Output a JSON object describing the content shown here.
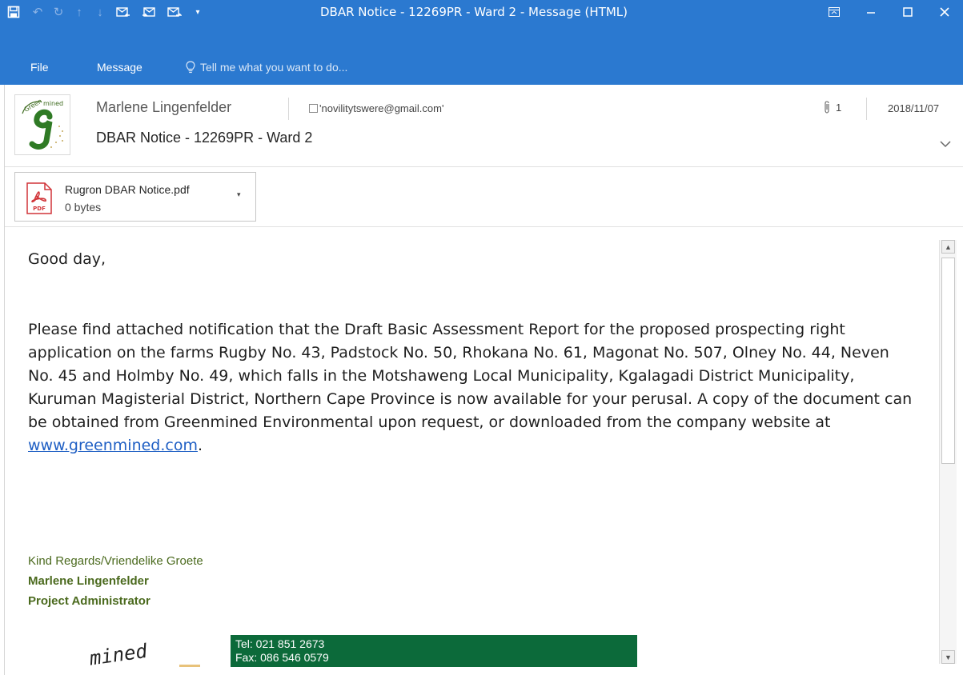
{
  "window": {
    "title": "DBAR Notice - 12269PR - Ward 2 - Message (HTML)",
    "controls": {
      "ribbon_display_icon": "ribbon-display-icon",
      "minimize_icon": "minimize-icon",
      "maximize_icon": "maximize-icon",
      "close_icon": "close-icon"
    },
    "title_bar_color": "#2b79d0"
  },
  "quick_access": {
    "icons": [
      "save-icon",
      "undo-icon",
      "redo-icon",
      "previous-item-icon",
      "next-item-icon",
      "reply-icon",
      "reply-all-icon",
      "forward-icon",
      "customize-icon"
    ]
  },
  "menu": {
    "file": "File",
    "message": "Message",
    "tell_me": "Tell me what you want to do..."
  },
  "header": {
    "sender": "Marlene Lingenfelder",
    "to": "'novilitytswere@gmail.com'",
    "subject": "DBAR Notice - 12269PR - Ward 2",
    "attachment_count": "1",
    "date": "2018/11/07"
  },
  "attachment": {
    "name": "Rugron DBAR Notice.pdf",
    "size": "0 bytes",
    "icon_label": "PDF"
  },
  "body": {
    "greeting": "Good day,",
    "paragraph": "Please find attached notification that the Draft Basic Assessment Report for the proposed prospecting right application on the farms Rugby No. 43, Padstock No. 50, Rhokana No. 61, Magonat No. 507, Olney No. 44, Neven No. 45 and Holmby No. 49, which falls in the Motshaweng Local Municipality, Kgalagadi District Municipality, Kuruman Magisterial District, Northern Cape Province is now available for your perusal. A copy of the document can be obtained from Greenmined Environmental upon request, or downloaded from the company website at ",
    "link": "www.greenmined.com",
    "link_suffix": ".",
    "signature": {
      "regards": "Kind Regards/Vriendelike Groete",
      "name": "Marlene Lingenfelder",
      "title": "Project Administrator",
      "tel": "Tel: 021 851 2673",
      "fax": "Fax: 086 546 0579",
      "logo_text": "mined"
    }
  },
  "colors": {
    "signature_green": "#4b6a1e",
    "contact_box": "#0c6a3a",
    "link_blue": "#1f5fc4"
  }
}
